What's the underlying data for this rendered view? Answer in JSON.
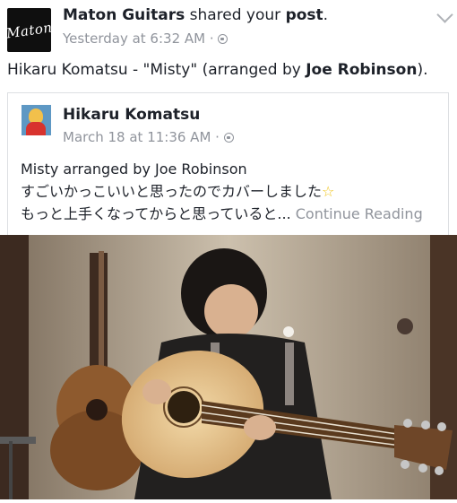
{
  "post": {
    "page_name": "Maton Guitars",
    "action_text": " shared your ",
    "object_text": "post",
    "period": ".",
    "timestamp": "Yesterday at 6:32 AM",
    "dot": " · ",
    "avatar_logo_text": "Maton"
  },
  "caption": {
    "prefix": "Hikaru Komatsu - \"Misty\" (arranged by ",
    "bold": "Joe Robinson",
    "suffix": ")."
  },
  "shared_post": {
    "author": "Hikaru  Komatsu",
    "timestamp": "March 18 at 11:36 AM",
    "dot": " · ",
    "line1": "Misty arranged by Joe Robinson",
    "line2": "すごいかっこいいと思ったのでカバーしました",
    "line2_emoji": "☆",
    "line3": "もっと上手くなってからと思っていると... ",
    "continue_label": "Continue Reading"
  },
  "icons": {
    "privacy": "globe-icon",
    "menu": "chevron-down-icon",
    "emoji": "star-emoji"
  },
  "colors": {
    "text": "#1d2129",
    "meta": "#90949c",
    "border": "#dddfe2",
    "emoji": "#f0c419"
  }
}
